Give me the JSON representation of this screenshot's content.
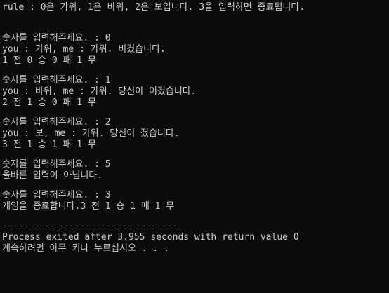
{
  "console": {
    "rule_line": "rule : 0은 가위, 1은 바위, 2은 보입니다. 3을 입력하면 종료됩니다.",
    "rounds": [
      {
        "prompt": "숫자를 입력해주세요. : 0",
        "result": "you : 가위, me : 가위. 비겼습니다.",
        "score": "1 전 0 승 0 패 1 무"
      },
      {
        "prompt": "숫자를 입력해주세요. : 1",
        "result": "you : 바위, me : 가위. 당신이 이겼습니다.",
        "score": "2 전 1 승 0 패 1 무"
      },
      {
        "prompt": "숫자를 입력해주세요. : 2",
        "result": "you : 보, me : 가위. 당신이 졌습니다.",
        "score": "3 전 1 승 1 패 1 무"
      },
      {
        "prompt": "숫자를 입력해주세요. : 5",
        "result": "올바른 입력이 아닙니다.",
        "score": ""
      },
      {
        "prompt": "숫자를 입력해주세요. : 3",
        "result": "게임을 종료합니다.3 전 1 승 1 패 1 무",
        "score": ""
      }
    ],
    "separator": "--------------------------------",
    "exit_message": "Process exited after 3.955 seconds with return value 0",
    "continue_message": "계속하려면 아무 키나 누르십시오 . . ."
  }
}
